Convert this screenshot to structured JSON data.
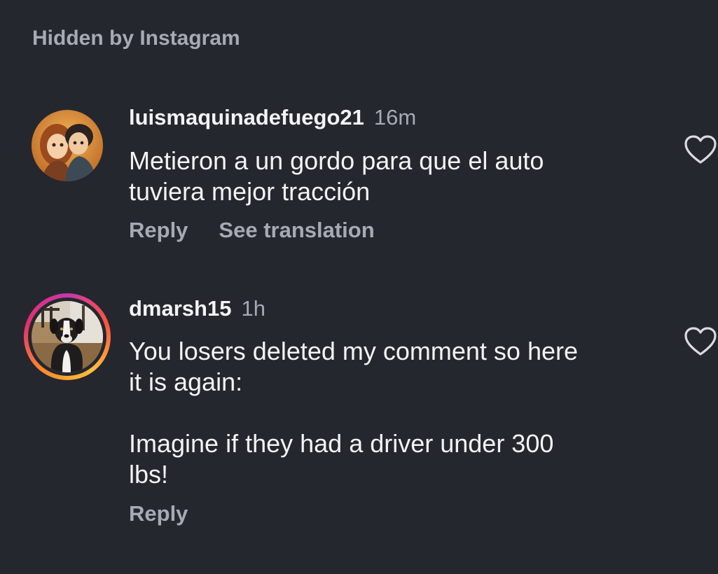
{
  "hidden_note": "Hidden by Instagram",
  "comments": [
    {
      "username": "luismaquinadefuego21",
      "time": "16m",
      "body": [
        "Metieron a un gordo para que el auto",
        "tuviera mejor tracción"
      ],
      "reply_label": "Reply",
      "translate_label": "See translation",
      "avatar_icon": "anime-couple-avatar",
      "like_icon": "heart-outline-icon"
    },
    {
      "username": "dmarsh15",
      "time": "1h",
      "body": [
        "You losers deleted my comment so here",
        "it is again:",
        "",
        "Imagine if they had a driver under 300",
        "lbs!"
      ],
      "reply_label": "Reply",
      "avatar_icon": "dog-avatar-with-story-ring",
      "like_icon": "heart-outline-icon"
    }
  ],
  "colors": {
    "background": "#25272e",
    "primary_text": "#f2f3f5",
    "secondary_text": "#a6aab3"
  }
}
